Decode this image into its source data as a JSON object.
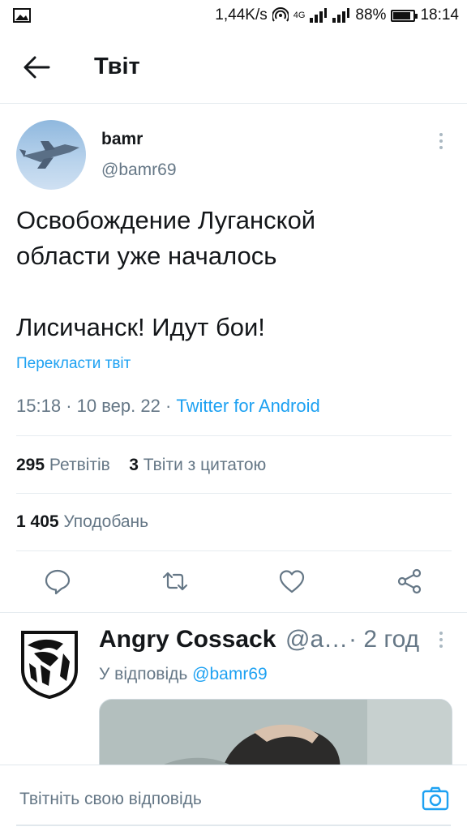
{
  "status_bar": {
    "speed": "1,44K/s",
    "network": "4G",
    "battery_percent": "88%",
    "battery_level": 0.88,
    "time": "18:14"
  },
  "header": {
    "title": "Твіт"
  },
  "tweet": {
    "author_name": "bamr",
    "author_handle": "@bamr69",
    "text": "Освобождение Луганской\nобласти уже началось\n\nЛисичанск! Идут бои!",
    "translate_label": "Перекласти твіт",
    "time": "15:18",
    "date": "10 вер. 22",
    "client": "Twitter for Android",
    "retweets_count": "295",
    "retweets_label": "Ретвітів",
    "quotes_count": "3",
    "quotes_label": "Твіти з цитатою",
    "likes_count": "1 405",
    "likes_label": "Уподобань"
  },
  "actions": [
    "reply-icon",
    "retweet-icon",
    "like-icon",
    "share-icon"
  ],
  "reply": {
    "author_name": "Angry Cossack",
    "author_handle": "@a…",
    "time": "· 2 год",
    "reply_prefix": "У відповідь",
    "reply_to": "@bamr69"
  },
  "composer": {
    "placeholder": "Твітніть свою відповідь"
  },
  "colors": {
    "accent": "#1da1f2",
    "secondary_text": "#657786",
    "divider": "#e6ecf0"
  }
}
